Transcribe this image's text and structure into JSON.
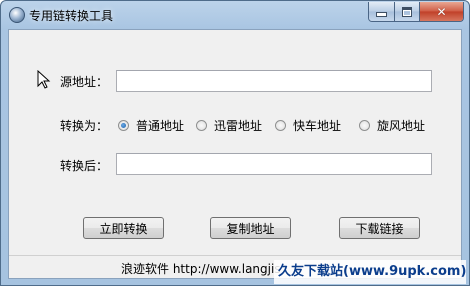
{
  "window": {
    "title": "专用链转换工具",
    "minimize_glyph": "minimize-icon",
    "maximize_glyph": "maximize-icon",
    "close_glyph": "✕"
  },
  "form": {
    "source_label": "源地址：",
    "source_value": "",
    "convert_to_label": "转换为：",
    "options": [
      {
        "label": "普通地址",
        "checked": true
      },
      {
        "label": "迅雷地址",
        "checked": false
      },
      {
        "label": "快车地址",
        "checked": false
      },
      {
        "label": "旋风地址",
        "checked": false
      }
    ],
    "result_label": "转换后：",
    "result_value": ""
  },
  "buttons": {
    "convert": "立即转换",
    "copy": "复制地址",
    "download": "下载链接"
  },
  "status": {
    "text": "浪迹软件 http://www.langjis"
  },
  "watermark": {
    "text": "久友下载站(www.9upk.com)"
  },
  "colors": {
    "title_bar": "#a9c5e2",
    "close_button": "#c03f28",
    "client_bg": "#f0f0f0",
    "watermark_text": "#0b3d8c",
    "radio_selected": "#1a5ea8"
  }
}
